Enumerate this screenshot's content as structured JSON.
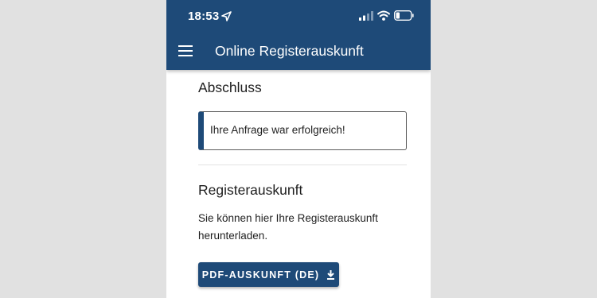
{
  "status_bar": {
    "time": "18:53",
    "icons": [
      "location-arrow-icon",
      "cellular-signal-icon",
      "wifi-icon",
      "battery-low-icon"
    ]
  },
  "app_bar": {
    "title": "Online Registerauskunft",
    "menu_icon": "hamburger-menu-icon"
  },
  "completion": {
    "heading": "Abschluss",
    "alert_text": "Ihre Anfrage war erfolgreich!"
  },
  "register": {
    "heading": "Registerauskunft",
    "description": "Sie können hier Ihre Registerauskunft herunterladen.",
    "download_button": "PDF-AUSKUNFT (DE)",
    "download_icon": "download-icon"
  },
  "colors": {
    "primary": "#1e4a78",
    "background": "#e1e1e1",
    "surface": "#ffffff",
    "text": "#1f1f1f"
  }
}
